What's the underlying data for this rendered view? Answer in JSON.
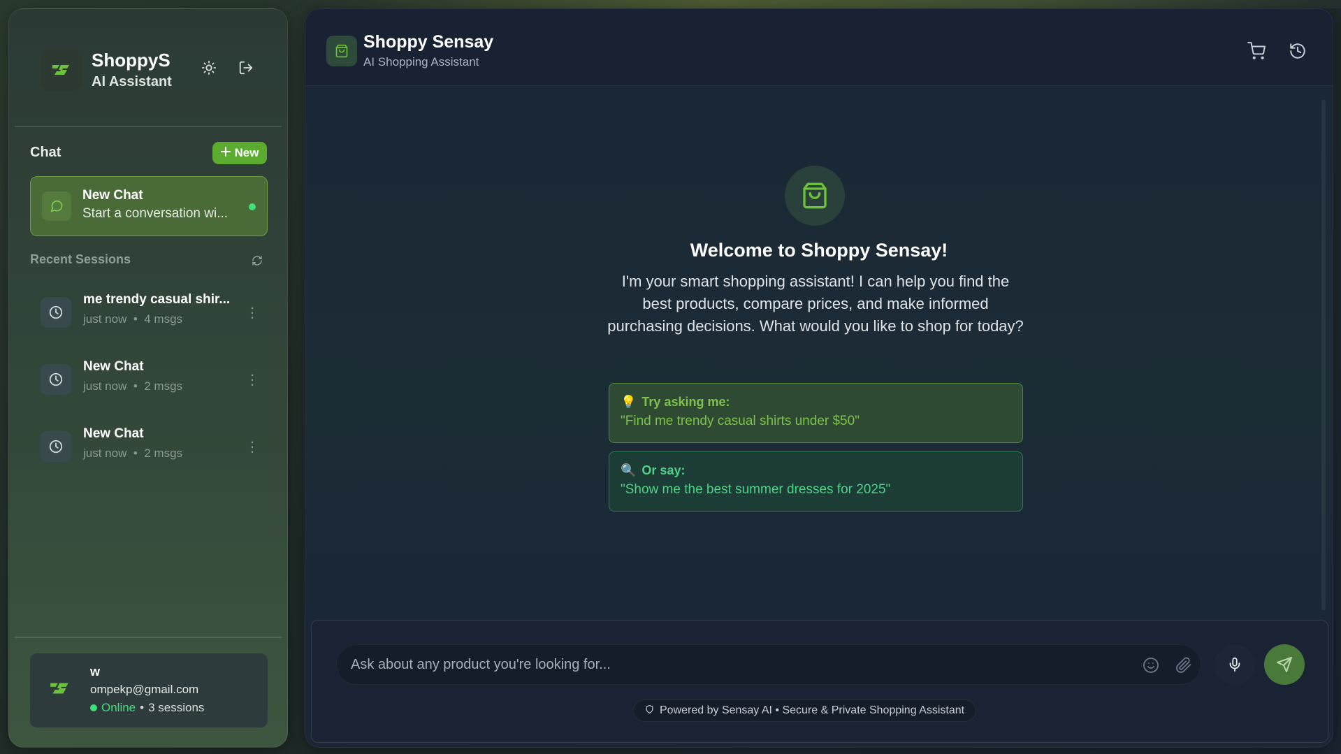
{
  "sidebar": {
    "brand_name": "ShoppyS",
    "brand_subtitle": "AI Assistant",
    "chat_section_label": "Chat",
    "new_button_label": "New",
    "active_chat": {
      "title": "New Chat",
      "preview": "Start a conversation wi..."
    },
    "recent_sessions_label": "Recent Sessions",
    "sessions": [
      {
        "title": "me trendy casual shir...",
        "time": "just now",
        "count": "4 msgs"
      },
      {
        "title": "New Chat",
        "time": "just now",
        "count": "2 msgs"
      },
      {
        "title": "New Chat",
        "time": "just now",
        "count": "2 msgs"
      }
    ],
    "user": {
      "name": "w",
      "email": "ompekp@gmail.com",
      "status": "Online",
      "sessions": "3 sessions"
    }
  },
  "main": {
    "title": "Shoppy Sensay",
    "subtitle": "AI Shopping Assistant",
    "welcome_title": "Welcome to Shoppy Sensay!",
    "welcome_text": "I'm your smart shopping assistant! I can help you find the best products, compare prices, and make informed purchasing decisions. What would you like to shop for today?",
    "suggestions": [
      {
        "emoji": "💡",
        "label": "Try asking me:",
        "quote": "\"Find me trendy casual shirts under $50\""
      },
      {
        "emoji": "🔍",
        "label": "Or say:",
        "quote": "\"Show me the best summer dresses for 2025\""
      }
    ],
    "input_placeholder": "Ask about any product you're looking for...",
    "powered_by": "Powered by Sensay AI • Secure & Private Shopping Assistant"
  },
  "colors": {
    "accent_green": "#5aab2f",
    "online_green": "#3fe07a",
    "suggestion_green": "#7ec24d",
    "suggestion_teal": "#4fd287"
  },
  "icons": [
    "logo-icon",
    "sun-icon",
    "logout-icon",
    "plus-icon",
    "message-icon",
    "refresh-icon",
    "clock-icon",
    "more-vertical-icon",
    "shopping-bag-icon",
    "cart-icon",
    "history-icon",
    "emoji-icon",
    "paperclip-icon",
    "microphone-icon",
    "send-icon",
    "shield-icon"
  ]
}
